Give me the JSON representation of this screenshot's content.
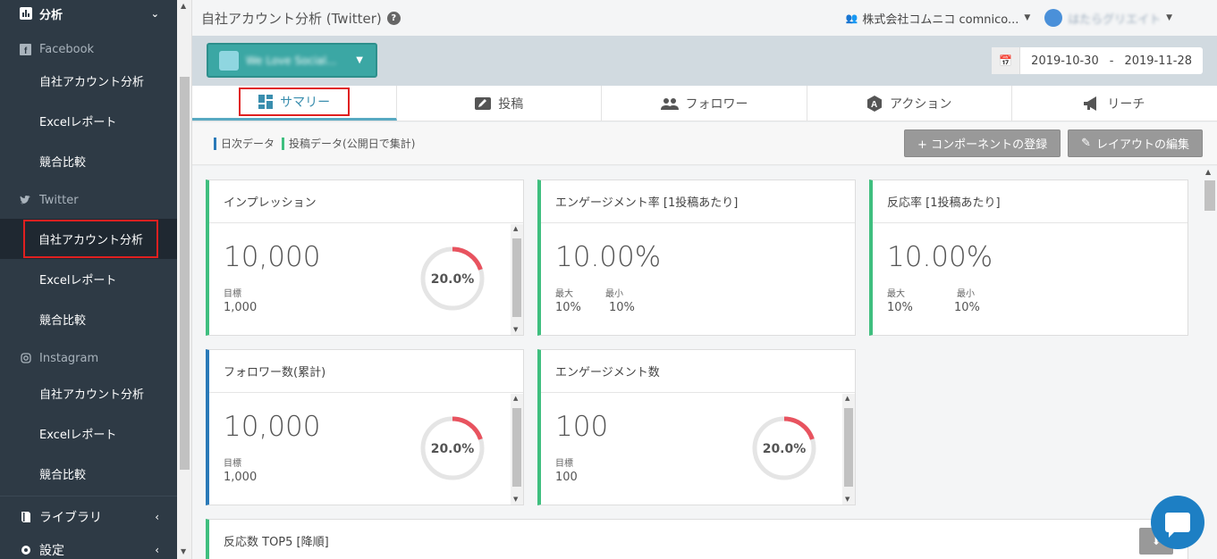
{
  "sidebar": {
    "top_section": "分析",
    "groups": [
      {
        "label": "Facebook",
        "items": [
          "自社アカウント分析",
          "Excelレポート",
          "競合比較"
        ]
      },
      {
        "label": "Twitter",
        "items": [
          "自社アカウント分析",
          "Excelレポート",
          "競合比較"
        ]
      },
      {
        "label": "Instagram",
        "items": [
          "自社アカウント分析",
          "Excelレポート",
          "競合比較"
        ]
      }
    ],
    "library": "ライブラリ",
    "settings": "設定"
  },
  "header": {
    "title": "自社アカウント分析 (Twitter)",
    "help": "?",
    "company": "株式会社コムニコ comnico...",
    "user_name": "はたらグリエイト"
  },
  "account_selector": {
    "name": "We Love Social..."
  },
  "date_range": {
    "start": "2019-10-30",
    "separator": "-",
    "end": "2019-11-28"
  },
  "tabs": [
    {
      "label": "サマリー",
      "icon": "dashboard-icon",
      "active": true
    },
    {
      "label": "投稿",
      "icon": "compose-icon",
      "active": false
    },
    {
      "label": "フォロワー",
      "icon": "users-icon",
      "active": false
    },
    {
      "label": "アクション",
      "icon": "action-icon",
      "active": false
    },
    {
      "label": "リーチ",
      "icon": "megaphone-icon",
      "active": false
    }
  ],
  "legend": {
    "daily": "日次データ",
    "post": "投稿データ(公開日で集計)",
    "daily_color": "#2a7ab8",
    "post_color": "#3fbf7f"
  },
  "buttons": {
    "add_component": "+ コンポーネントの登録",
    "edit_layout": "レイアウトの編集"
  },
  "cards": {
    "impression": {
      "title": "インプレッション",
      "value": "10,000",
      "target_label": "目標",
      "target": "1,000",
      "gauge": "20.0%",
      "gauge_fraction": 0.2
    },
    "engagement_rate": {
      "title": "エンゲージメント率 [1投稿あたり]",
      "value": "10.00%",
      "max_label": "最大",
      "max": "10%",
      "min_label": "最小",
      "min": "10%"
    },
    "reaction_rate": {
      "title": "反応率 [1投稿あたり]",
      "value": "10.00%",
      "max_label": "最大",
      "max": "10%",
      "min_label": "最小",
      "min": "10%"
    },
    "followers": {
      "title": "フォロワー数(累計)",
      "value": "10,000",
      "target_label": "目標",
      "target": "1,000",
      "gauge": "20.0%",
      "gauge_fraction": 0.2
    },
    "engagements": {
      "title": "エンゲージメント数",
      "value": "100",
      "target_label": "目標",
      "target": "100",
      "gauge": "20.0%",
      "gauge_fraction": 0.2
    },
    "top5": {
      "title": "反応数 TOP5 [降順]"
    }
  },
  "colors": {
    "sidebar": "#2e3a45",
    "accent_teal": "#3ba7a4",
    "gauge_red": "#e8535f"
  }
}
